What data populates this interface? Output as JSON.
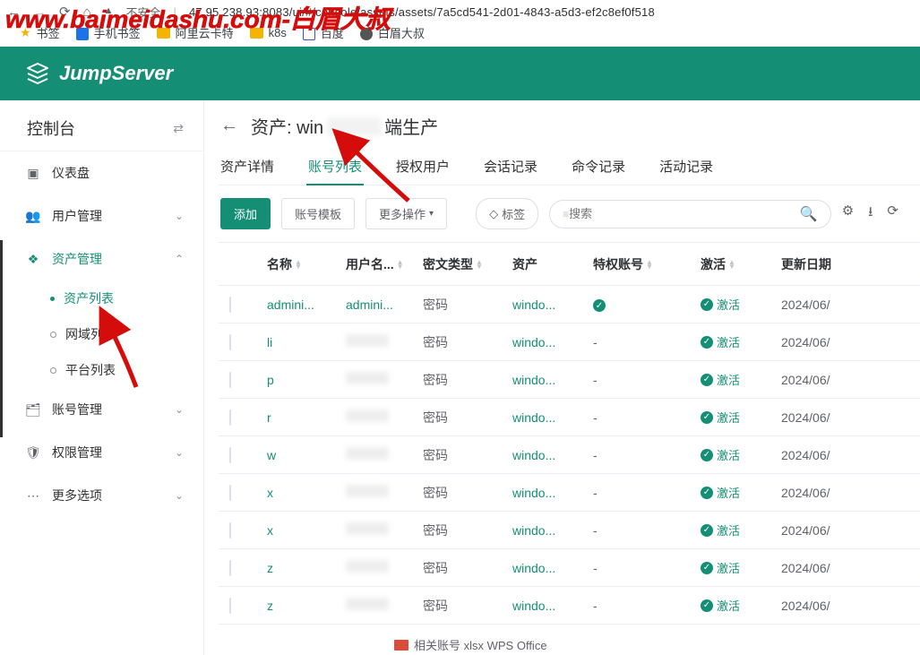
{
  "browser": {
    "insecure_label": "不安全",
    "url_sep": "|",
    "url": "47.95.238.93:8083/ui/#/console/assets/assets/7a5cd541-2d01-4843-a5d3-ef2c8ef0f518"
  },
  "bookmarks": {
    "b1": "书签",
    "b2": "手机书签",
    "b3": "阿里云卡特",
    "b4": "k8s",
    "b5": "百度",
    "b6": "白眉大叔"
  },
  "watermark": "www.baimeidashu.com-白眉大叔",
  "app_name": "JumpServer",
  "sidebar": {
    "title": "控制台",
    "items": [
      {
        "label": "仪表盘"
      },
      {
        "label": "用户管理"
      },
      {
        "label": "资产管理"
      },
      {
        "label": "账号管理"
      },
      {
        "label": "权限管理"
      },
      {
        "label": "更多选项"
      }
    ],
    "asset_sub": [
      {
        "label": "资产列表"
      },
      {
        "label": "网域列表"
      },
      {
        "label": "平台列表"
      }
    ]
  },
  "breadcrumb": {
    "prefix": "资产: win",
    "suffix": "端生产"
  },
  "tabs": [
    {
      "label": "资产详情"
    },
    {
      "label": "账号列表"
    },
    {
      "label": "授权用户"
    },
    {
      "label": "会话记录"
    },
    {
      "label": "命令记录"
    },
    {
      "label": "活动记录"
    }
  ],
  "toolbar": {
    "add": "添加",
    "tmpl": "账号模板",
    "more": "更多操作",
    "tag": "标签",
    "search_ph": "搜索"
  },
  "columns": {
    "name": "名称",
    "user": "用户名...",
    "secret": "密文类型",
    "asset": "资产",
    "priv": "特权账号",
    "active": "激活",
    "updated": "更新日期"
  },
  "cell": {
    "secret": "密码",
    "asset": "windo...",
    "priv_true_dash": "-",
    "active": "激活",
    "updated": "2024/06/"
  },
  "rows": [
    {
      "name": "admini...",
      "user": "admini...",
      "priv": "check"
    },
    {
      "name": "li",
      "user": "",
      "priv": "-"
    },
    {
      "name": "p",
      "user": "",
      "priv": "-"
    },
    {
      "name": "r",
      "user": "",
      "priv": "-"
    },
    {
      "name": "w",
      "user": "",
      "priv": "-"
    },
    {
      "name": "x",
      "user": "",
      "priv": "-"
    },
    {
      "name": "x",
      "user": "",
      "priv": "-"
    },
    {
      "name": "z",
      "user": "",
      "priv": "-"
    },
    {
      "name": "z",
      "user": "",
      "priv": "-"
    }
  ],
  "footer_hint": "相关账号 xlsx  WPS Office"
}
